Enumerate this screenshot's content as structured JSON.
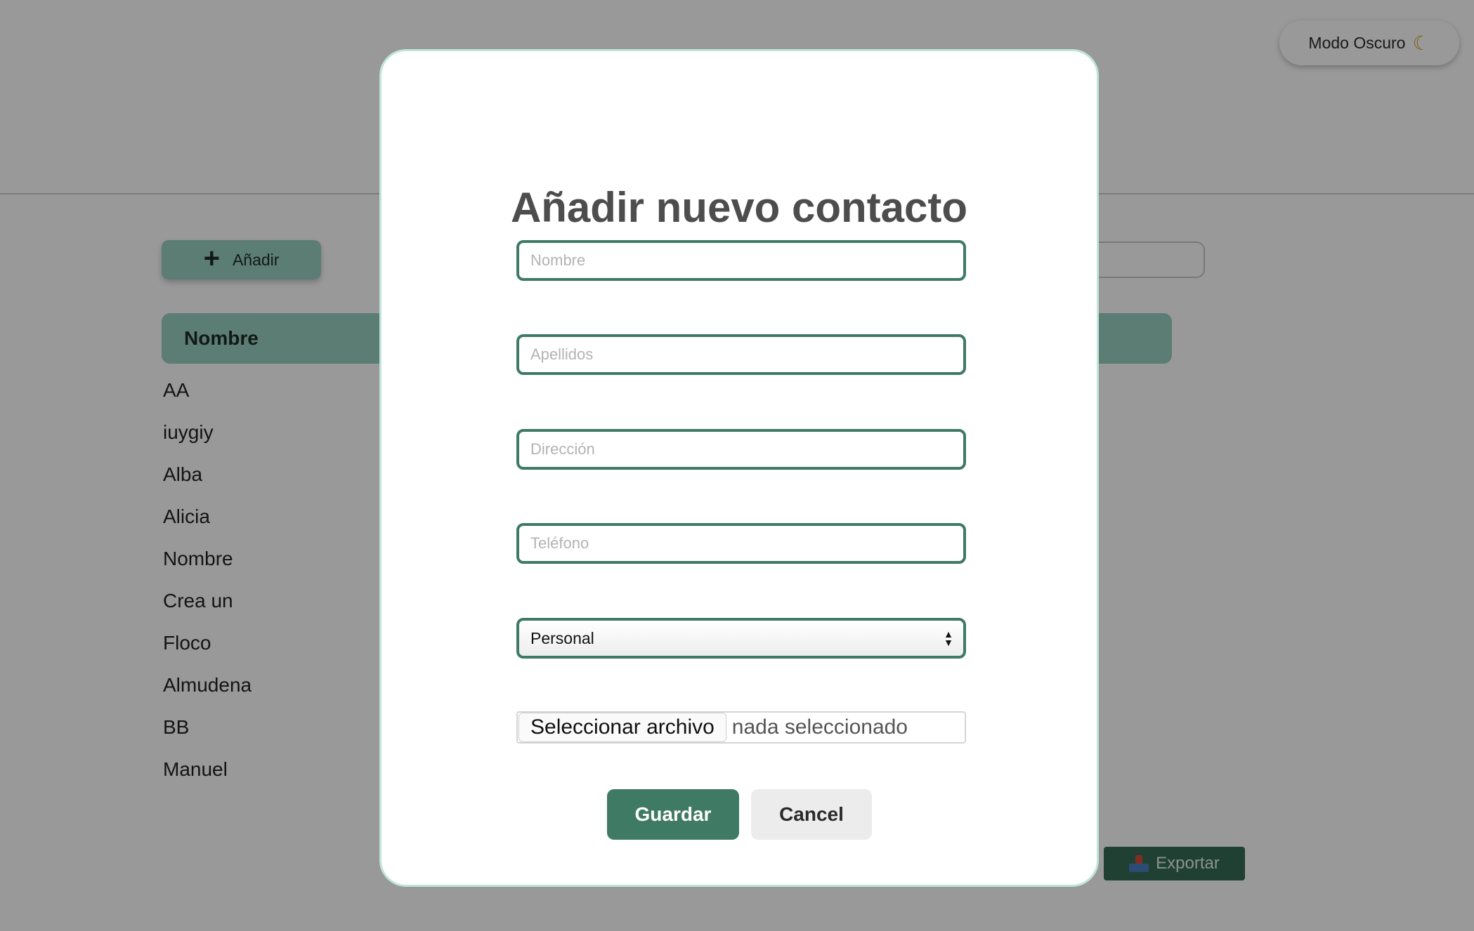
{
  "header": {
    "theme_toggle_label": "Modo Oscuro",
    "theme_icon": "moon-icon"
  },
  "toolbar": {
    "add_label": "Añadir",
    "add_icon": "plus-icon"
  },
  "table": {
    "column_header": "Nombre",
    "contacts": [
      "AA",
      "iuygiy",
      "Alba",
      "Alicia",
      "Nombre",
      "Crea un",
      "Floco",
      "Almudena",
      "BB",
      "Manuel"
    ]
  },
  "footer": {
    "export_label": "Exportar",
    "export_icon": "inbox-tray-icon"
  },
  "modal": {
    "title": "Añadir nuevo contacto",
    "fields": {
      "nombre_placeholder": "Nombre",
      "apellidos_placeholder": "Apellidos",
      "direccion_placeholder": "Dirección",
      "telefono_placeholder": "Teléfono"
    },
    "category_selected": "Personal",
    "file_button_label": "Seleccionar archivo",
    "file_status": "nada seleccionado",
    "save_label": "Guardar",
    "cancel_label": "Cancel"
  },
  "colors": {
    "primary": "#3f7a64",
    "accent_light": "#9ad0c0",
    "modal_border": "#bfe6d8",
    "export_bg": "#356b55"
  }
}
